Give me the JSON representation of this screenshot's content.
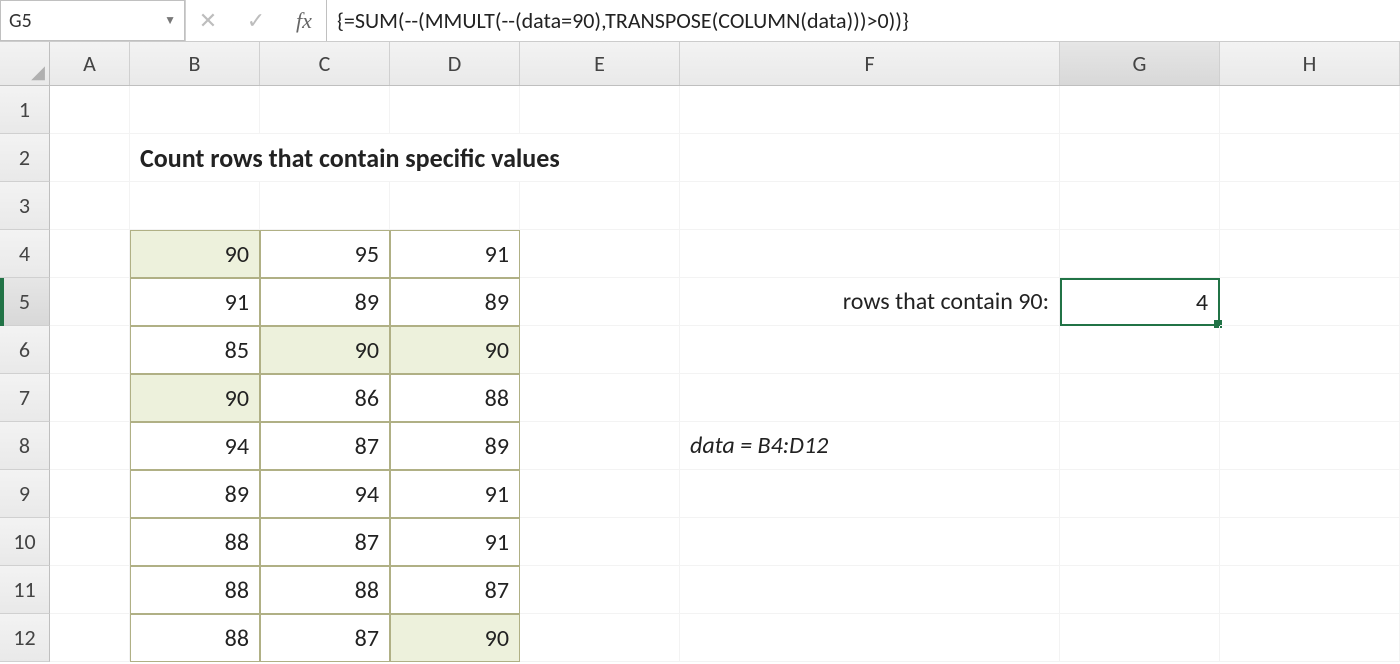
{
  "formula_bar": {
    "name_box": "G5",
    "formula": "{=SUM(--(MMULT(--(data=90),TRANSPOSE(COLUMN(data)))>0))}"
  },
  "columns": [
    "A",
    "B",
    "C",
    "D",
    "E",
    "F",
    "G",
    "H"
  ],
  "rows": [
    "1",
    "2",
    "3",
    "4",
    "5",
    "6",
    "7",
    "8",
    "9",
    "10",
    "11",
    "12"
  ],
  "title": "Count rows that contain specific values",
  "label_rows_contain": "rows that contain 90:",
  "result_value": "4",
  "data_label": "data = B4:D12",
  "table": [
    [
      90,
      95,
      91
    ],
    [
      91,
      89,
      89
    ],
    [
      85,
      90,
      90
    ],
    [
      90,
      86,
      88
    ],
    [
      94,
      87,
      89
    ],
    [
      89,
      94,
      91
    ],
    [
      88,
      87,
      91
    ],
    [
      88,
      88,
      87
    ],
    [
      88,
      87,
      90
    ]
  ],
  "highlight": [
    [
      true,
      false,
      false
    ],
    [
      false,
      false,
      false
    ],
    [
      false,
      true,
      true
    ],
    [
      true,
      false,
      false
    ],
    [
      false,
      false,
      false
    ],
    [
      false,
      false,
      false
    ],
    [
      false,
      false,
      false
    ],
    [
      false,
      false,
      false
    ],
    [
      false,
      false,
      true
    ]
  ],
  "active_cell": "G5",
  "active_col": "G",
  "active_row": "5"
}
